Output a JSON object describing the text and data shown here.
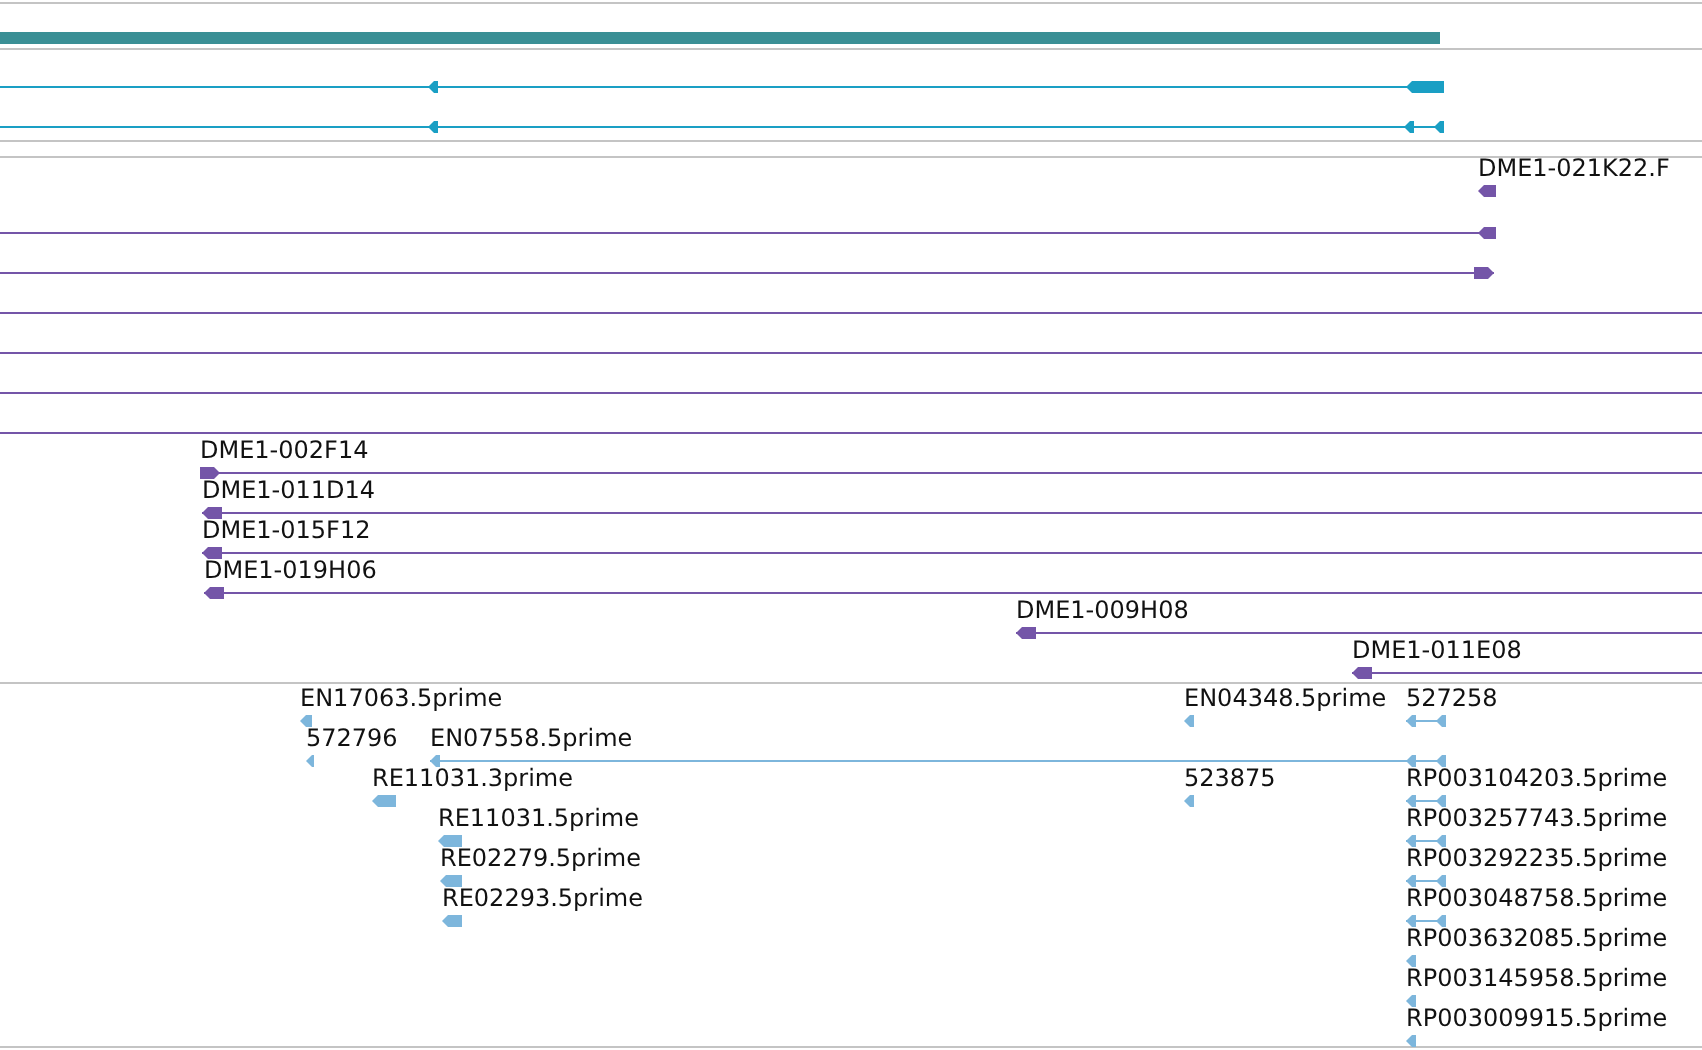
{
  "tracks": [
    {
      "color": "#3a8f95",
      "features": [
        {
          "kind": "block"
        }
      ]
    },
    {
      "color": "#1a9fc4",
      "features": [
        {
          "kind": "arrow",
          "reverse": true
        },
        {
          "kind": "arrow",
          "reverse": true
        }
      ]
    },
    {
      "color": "#7455a8",
      "features": [
        {
          "kind": "arrow",
          "reverse": true,
          "label": "DME1-021K22.F"
        },
        {
          "kind": "arrow",
          "reverse": true
        },
        {
          "kind": "arrow",
          "reverse": false
        },
        {
          "kind": "line"
        },
        {
          "kind": "line"
        },
        {
          "kind": "line"
        },
        {
          "kind": "line"
        },
        {
          "kind": "arrow",
          "reverse": false,
          "label": "DME1-002F14"
        },
        {
          "kind": "arrow",
          "reverse": true,
          "label": "DME1-011D14"
        },
        {
          "kind": "arrow",
          "reverse": true,
          "label": "DME1-015F12"
        },
        {
          "kind": "arrow",
          "reverse": true,
          "label": "DME1-019H06"
        },
        {
          "kind": "arrow",
          "reverse": true,
          "label": "DME1-009H08"
        },
        {
          "kind": "arrow",
          "reverse": true,
          "label": "DME1-011E08"
        }
      ]
    },
    {
      "color": "#7db6dc",
      "features": [
        {
          "kind": "arrow",
          "reverse": true,
          "label": "EN17063.5prime"
        },
        {
          "kind": "arrow",
          "reverse": true,
          "label": "572796"
        },
        {
          "kind": "arrow",
          "reverse": true,
          "label": "EN07558.5prime"
        },
        {
          "kind": "arrow",
          "reverse": true,
          "label": "EN04348.5prime"
        },
        {
          "kind": "arrow",
          "reverse": true,
          "label": "527258"
        },
        {
          "kind": "arrow",
          "reverse": true,
          "label": "RE11031.3prime"
        },
        {
          "kind": "arrow",
          "reverse": true,
          "label": "523875"
        },
        {
          "kind": "arrow",
          "reverse": true,
          "label": "RP003104203.5prime"
        },
        {
          "kind": "arrow",
          "reverse": true,
          "label": "RE11031.5prime"
        },
        {
          "kind": "arrow",
          "reverse": true,
          "label": "RP003257743.5prime"
        },
        {
          "kind": "arrow",
          "reverse": true,
          "label": "RE02279.5prime"
        },
        {
          "kind": "arrow",
          "reverse": true,
          "label": "RP003292235.5prime"
        },
        {
          "kind": "arrow",
          "reverse": true,
          "label": "RE02293.5prime"
        },
        {
          "kind": "arrow",
          "reverse": true,
          "label": "RP003048758.5prime"
        },
        {
          "kind": "arrow",
          "reverse": true,
          "label": "RP003632085.5prime"
        },
        {
          "kind": "arrow",
          "reverse": true,
          "label": "RP003145958.5prime"
        },
        {
          "kind": "arrow",
          "reverse": true,
          "label": "RP003009915.5prime"
        }
      ]
    }
  ]
}
